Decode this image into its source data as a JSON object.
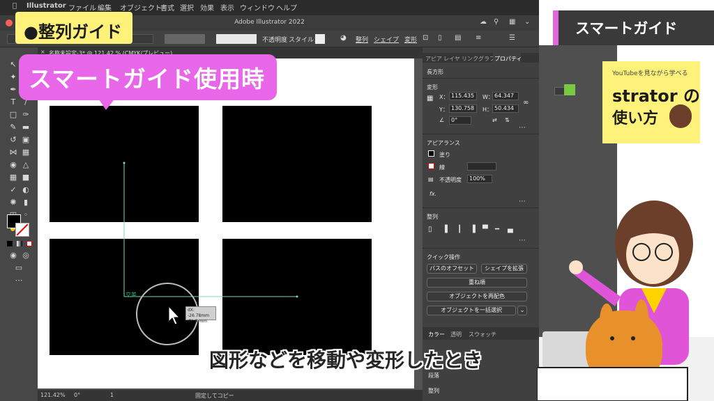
{
  "menubar": {
    "items": [
      "Illustrator",
      "ファイル",
      "編集",
      "オブジェクト",
      "書式",
      "選択",
      "効果",
      "表示",
      "ウィンドウ",
      "ヘルプ"
    ]
  },
  "window": {
    "title": "Adobe Illustrator 2022"
  },
  "control_bar": {
    "opacity_label": "不透明度",
    "style_label": "スタイル：",
    "align_label": "整列",
    "shape_label": "シェイプ",
    "transform_label": "変形"
  },
  "document_tab": {
    "label": "名称未設定-3* @ 121.42 % (CMYK/プレビュー)",
    "close": "×"
  },
  "panel": {
    "tabs": [
      "アピア",
      "レイヤ",
      "リンク",
      "グラフ",
      "プロパティ"
    ],
    "object_type": "長方形",
    "transform": {
      "heading": "変形",
      "x_label": "X：",
      "x_value": "115.435",
      "y_label": "Y：",
      "y_value": "130.758",
      "w_label": "W：",
      "w_value": "64.347",
      "h_label": "H：",
      "h_value": "50.434",
      "angle_value": "0°"
    },
    "appearance": {
      "heading": "アピアランス",
      "fill_label": "塗り",
      "stroke_label": "線",
      "opacity_label": "不透明度",
      "opacity_value": "100%",
      "fx_label": "fx."
    },
    "align": {
      "heading": "整列"
    },
    "quick_actions": {
      "heading": "クイック操作",
      "offset_path": "パスのオフセット",
      "expand_shape": "シェイプを拡張",
      "arrange": "重ね順",
      "recolor": "オブジェクトを再配色",
      "select_same": "オブジェクトを一括選択"
    },
    "bottom_tabs": [
      "カラー",
      "透明",
      "スウォッチ"
    ],
    "collapsed": [
      "段落",
      "整列"
    ]
  },
  "statusbar": {
    "zoom": "121.42%",
    "rotate": "0°",
    "page": "1",
    "status": "固定してコピー"
  },
  "smart_guide": {
    "intersect_label": "交差",
    "dx": "dX: -26.78mm",
    "dy": "dY: 0 mm"
  },
  "overlay": {
    "badge_left": "●整列ガイド",
    "badge_right": "スマートガイド",
    "bubble": "スマートガイド使用時",
    "subtitle": "図形などを移動や変形したとき",
    "book_line1": "YouTubeを見ながら学べる",
    "book_line2": "strator の",
    "book_line3": "使い方"
  },
  "colors": {
    "accent_pink": "#e866e8",
    "badge_yellow": "#fff27a",
    "guide_green": "#22b573"
  }
}
